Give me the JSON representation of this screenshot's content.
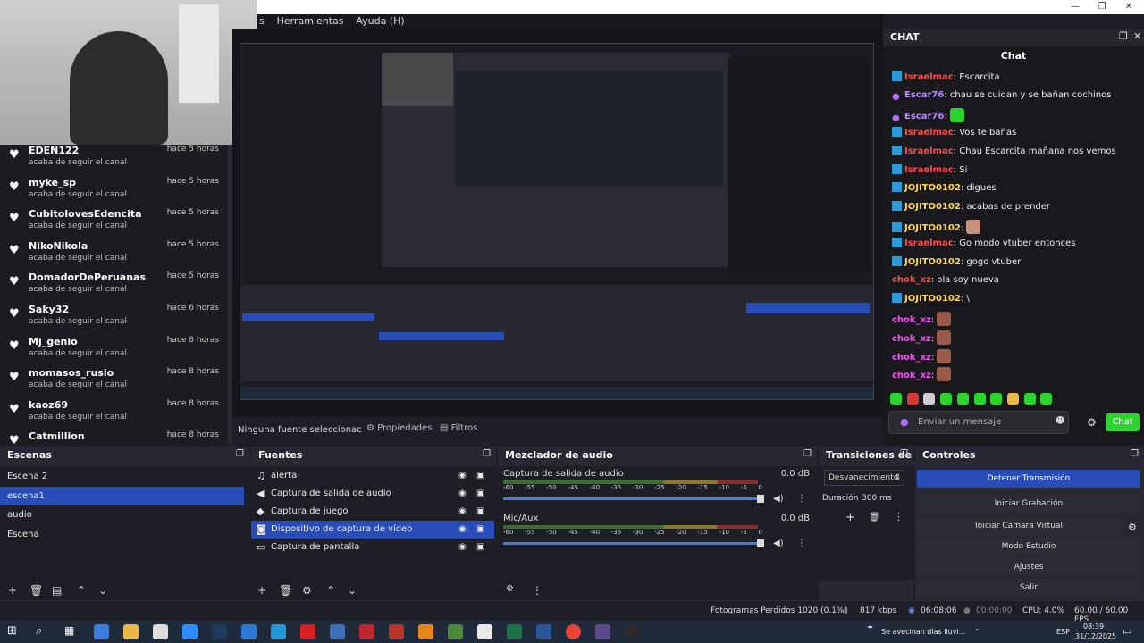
{
  "menu": {
    "items": [
      "s",
      "Herramientas",
      "Ayuda (H)"
    ]
  },
  "followers": [
    {
      "name": "EDEN122",
      "time": "hace 5 horas",
      "sub": "acaba de seguir el canal"
    },
    {
      "name": "myke_sp",
      "time": "hace 5 horas",
      "sub": "acaba de seguir el canal"
    },
    {
      "name": "CubitolovesEdencita",
      "time": "hace 5 horas",
      "sub": "acaba de seguir el canal"
    },
    {
      "name": "NikoNikola",
      "time": "hace 5 horas",
      "sub": "acaba de seguir el canal"
    },
    {
      "name": "DomadorDePeruanas",
      "time": "hace 5 horas",
      "sub": "acaba de seguir el canal"
    },
    {
      "name": "Saky32",
      "time": "hace 6 horas",
      "sub": "acaba de seguir el canal"
    },
    {
      "name": "Mj_genio",
      "time": "hace 8 horas",
      "sub": "acaba de seguir el canal"
    },
    {
      "name": "momasos_rusio",
      "time": "hace 8 horas",
      "sub": "acaba de seguir el canal"
    },
    {
      "name": "kaoz69",
      "time": "hace 8 horas",
      "sub": "acaba de seguir el canal"
    },
    {
      "name": "Catmillion",
      "time": "hace 8 horas",
      "sub": ""
    }
  ],
  "chat": {
    "dock_title": "CHAT",
    "title": "Chat",
    "messages": [
      {
        "user": "Israelmac",
        "color": "#ff4b4b",
        "badge": "verified",
        "text": ": Escarcita"
      },
      {
        "user": "Escar76",
        "color": "#b888ff",
        "badge": "mic",
        "text": ": chau se cuidan y se bañan cochinos"
      },
      {
        "user": "Escar76",
        "color": "#b888ff",
        "badge": "mic",
        "text": ": ",
        "emote": "#2ed42e"
      },
      {
        "user": "Israelmac",
        "color": "#ff4b4b",
        "badge": "verified",
        "text": ": Vos te bañas"
      },
      {
        "user": "Israelmac",
        "color": "#ff4b4b",
        "badge": "verified",
        "text": ": Chau Escarcita mañana nos vemos"
      },
      {
        "user": "Israelmac",
        "color": "#ff4b4b",
        "badge": "verified",
        "text": ": Si"
      },
      {
        "user": "JOJITO0102",
        "color": "#ffd84b",
        "badge": "verified",
        "text": ": digues"
      },
      {
        "user": "JOJITO0102",
        "color": "#ffd84b",
        "badge": "verified",
        "text": ": acabas de prender"
      },
      {
        "user": "JOJITO0102",
        "color": "#ffd84b",
        "badge": "verified",
        "text": ": ",
        "emote": "#c98f7a"
      },
      {
        "user": "Israelmac",
        "color": "#ff4b4b",
        "badge": "verified",
        "text": ": Go modo vtuber entonces"
      },
      {
        "user": "JOJITO0102",
        "color": "#ffd84b",
        "badge": "verified",
        "text": ": gogo vtuber"
      },
      {
        "user": "chok_xz",
        "color": "#ff4b4b",
        "badge": "none",
        "text": ": ola soy nueva"
      },
      {
        "user": "JOJITO0102",
        "color": "#ffd84b",
        "badge": "verified",
        "text": ": \\"
      },
      {
        "user": "chok_xz",
        "color": "#ff4bff",
        "badge": "none",
        "text": ": ",
        "emote": "#9a5a4a"
      },
      {
        "user": "chok_xz",
        "color": "#ff4bff",
        "badge": "none",
        "text": ": ",
        "emote": "#9a5a4a"
      },
      {
        "user": "chok_xz",
        "color": "#ff4bff",
        "badge": "none",
        "text": ": ",
        "emote": "#9a5a4a"
      },
      {
        "user": "chok_xz",
        "color": "#ff4bff",
        "badge": "none",
        "text": ": ",
        "emote": "#9a5a4a"
      }
    ],
    "input_placeholder": "Enviar un mensaje",
    "send_label": "Chat"
  },
  "source_toolbar": {
    "no_source": "Ninguna fuente seleccionac",
    "properties": "Propiedades",
    "filters": "Filtros"
  },
  "scenes": {
    "title": "Escenas",
    "items": [
      "Escena 2",
      "escena1",
      "audio",
      "Escena"
    ],
    "selected": 1
  },
  "sources": {
    "title": "Fuentes",
    "items": [
      {
        "icon": "bell-icon",
        "glyph": "♫",
        "name": "alerta"
      },
      {
        "icon": "speaker-icon",
        "glyph": "◀",
        "name": "Captura de salida de audio"
      },
      {
        "icon": "gamepad-icon",
        "glyph": "◆",
        "name": "Captura de juego"
      },
      {
        "icon": "camera-icon",
        "glyph": "◙",
        "name": "Dispositivo de captura de vídeo"
      },
      {
        "icon": "monitor-icon",
        "glyph": "▭",
        "name": "Captura de pantalla"
      }
    ],
    "selected": 3
  },
  "mixer": {
    "title": "Mezclador de audio",
    "channels": [
      {
        "name": "Captura de salida de audio",
        "db": "0.0 dB",
        "level": 0.6
      },
      {
        "name": "Mic/Aux",
        "db": "0.0 dB",
        "level": 0.4
      }
    ],
    "ticks": [
      "-60",
      "-55",
      "-50",
      "-45",
      "-40",
      "-35",
      "-30",
      "-25",
      "-20",
      "-15",
      "-10",
      "-5",
      "0"
    ]
  },
  "transitions": {
    "title": "Transiciones de ...",
    "selected": "Desvanecimiento",
    "duration_label": "Duración",
    "duration_value": "300 ms"
  },
  "controls": {
    "title": "Controles",
    "buttons": [
      "Detener Transmisión",
      "Iniciar Grabación",
      "Iniciar Cámara Virtual",
      "Modo Estudio",
      "Ajustes",
      "Salir"
    ]
  },
  "status": {
    "frames": "Fotogramas Perdidos 1020 (0.1%)",
    "bitrate": "817 kbps",
    "stream_time": "06:08:06",
    "rec_time": "00:00:00",
    "cpu": "CPU: 4.0%",
    "fps": "60.00 / 60.00 FPS"
  },
  "taskbar": {
    "weather": "Se avecinan días lluvi...",
    "lang": "ESP",
    "time": "08:39",
    "date": "31/12/2025"
  },
  "colors": {
    "accent": "#284cb8",
    "chat_green": "#2ed42e"
  }
}
